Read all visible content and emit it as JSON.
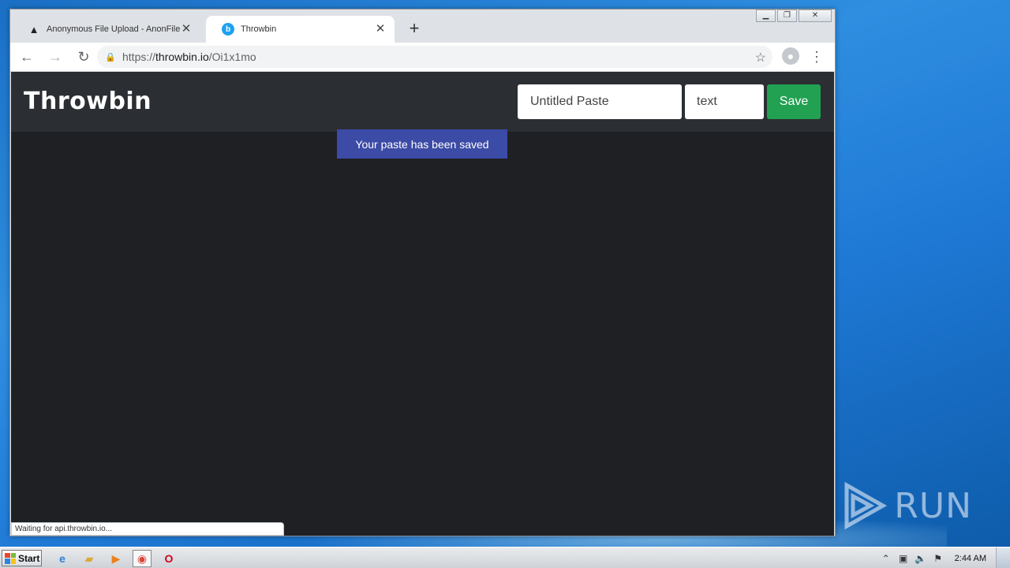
{
  "browser": {
    "tabs": [
      {
        "title": "Anonymous File Upload - AnonFile",
        "icon": "anonfile-favicon-icon"
      },
      {
        "title": "Throwbin",
        "icon": "throwbin-favicon-icon"
      }
    ],
    "url": {
      "scheme": "https://",
      "host": "throwbin.io",
      "path": "/Oi1x1mo"
    },
    "status_text": "Waiting for api.throwbin.io..."
  },
  "page": {
    "logo": "Throwbin",
    "title_input": {
      "value": "Untitled Paste"
    },
    "type_input": {
      "value": "text"
    },
    "save_label": "Save",
    "toast": "Your paste has been saved",
    "colors": {
      "header_bg": "#2b2e33",
      "body_bg": "#1e2024",
      "save_green": "#21a151",
      "toast_blue": "#3c4ba6"
    }
  },
  "taskbar": {
    "start_label": "Start",
    "clock": "2:44 AM"
  },
  "watermark": "ANY RUN"
}
